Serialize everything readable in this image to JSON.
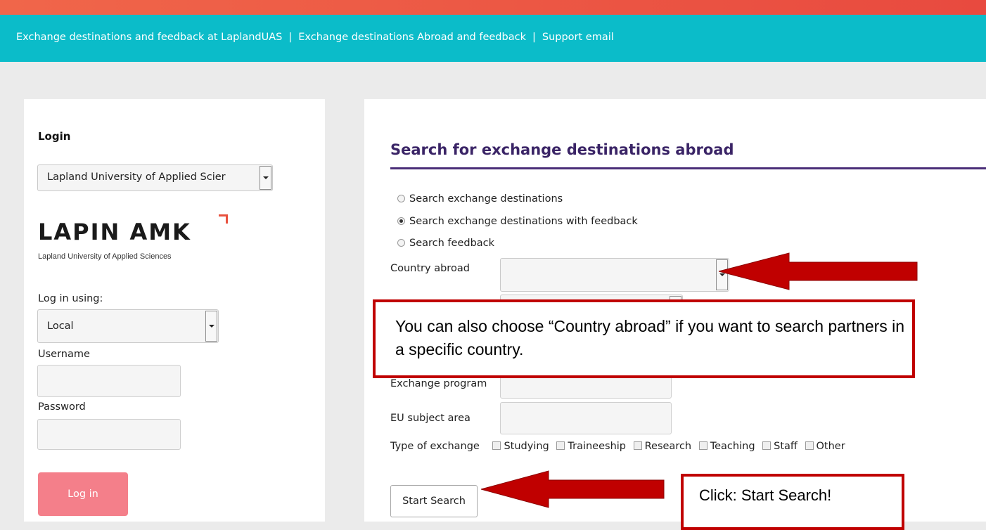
{
  "nav": {
    "link1": "Exchange destinations and feedback at LaplandUAS",
    "link2": "Exchange destinations Abroad and feedback",
    "link3": "Support email",
    "separator": "|"
  },
  "login": {
    "title": "Login",
    "organization_select": "Lapland University of Applied Scier",
    "logo_text": "LAPIN AMK",
    "logo_subtext": "Lapland University of Applied Sciences",
    "login_method_label": "Log in using:",
    "login_method_value": "Local",
    "username_label": "Username",
    "username_value": "",
    "password_label": "Password",
    "password_value": "",
    "button_label": "Log in"
  },
  "search": {
    "title": "Search for exchange destinations abroad",
    "radio_options": [
      {
        "label": "Search exchange destinations",
        "selected": false
      },
      {
        "label": "Search exchange destinations with feedback",
        "selected": true
      },
      {
        "label": "Search feedback",
        "selected": false
      }
    ],
    "country_label": "Country abroad",
    "country_value": "",
    "exchange_program_label": "Exchange program",
    "exchange_program_value": "",
    "eu_subject_label": "EU subject area",
    "eu_subject_value": "",
    "type_label": "Type of exchange",
    "types": [
      "Studying",
      "Traineeship",
      "Research",
      "Teaching",
      "Staff",
      "Other"
    ],
    "start_button": "Start Search"
  },
  "annotations": {
    "callout_country": "You can also choose “Country abroad” if you want to search partners in a specific country.",
    "callout_start": "Click: Start Search!",
    "arrow_color": "#c00000"
  },
  "colors": {
    "top_stripe": "#e84a3f",
    "navbar": "#0bbcc9",
    "title": "#3a2466",
    "login_button": "#f47f8a"
  }
}
